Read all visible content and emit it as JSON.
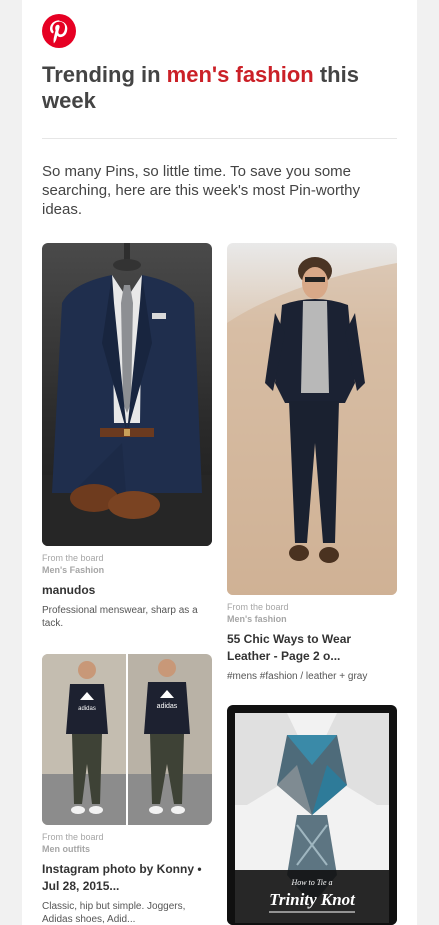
{
  "brand": {
    "logo_icon": "pinterest-logo-icon",
    "color": "#e60023"
  },
  "headline": {
    "prefix": "Trending in ",
    "topic": "men's fashion",
    "suffix": " this week",
    "topic_color": "#cb2027"
  },
  "intro": "So many Pins, so little time. To save you some searching, here are this week's most Pin-worthy ideas.",
  "pins": [
    {
      "from_label": "From the board",
      "board": "Men's Fashion",
      "title": "manudos",
      "description": "Professional menswear, sharp as a tack.",
      "image_icon": "suit-on-mannequin-photo"
    },
    {
      "from_label": "From the board",
      "board": "Men's fashion",
      "title": "55 Chic Ways to Wear Leather - Page 2 o...",
      "description": "#mens #fashion / leather + gray",
      "image_icon": "leather-jacket-man-photo"
    },
    {
      "from_label": "From the board",
      "board": "Men outfits",
      "title": "Instagram photo by Konny • Jul 28, 2015...",
      "description": "Classic, hip but simple. Joggers, Adidas shoes, Adid...",
      "image_icon": "adidas-outfit-photo"
    },
    {
      "image_icon": "trinity-knot-tie-photo",
      "image_caption_small": "How to Tie a",
      "image_caption_large": "Trinity Knot"
    }
  ],
  "image_texts": {
    "shirt_brand": "adidas"
  }
}
